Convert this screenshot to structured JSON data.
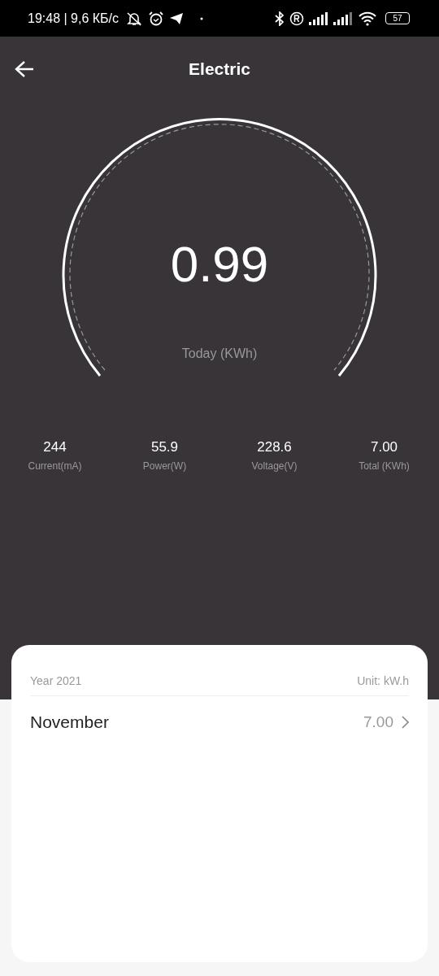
{
  "status_bar": {
    "time": "19:48 | 9,6 КБ/с",
    "battery": "57"
  },
  "header": {
    "title": "Electric"
  },
  "gauge": {
    "value": "0.99",
    "label": "Today (KWh)"
  },
  "stats": [
    {
      "value": "244",
      "label": "Current(mA)"
    },
    {
      "value": "55.9",
      "label": "Power(W)"
    },
    {
      "value": "228.6",
      "label": "Voltage(V)"
    },
    {
      "value": "7.00",
      "label": "Total (KWh)"
    }
  ],
  "history": {
    "year": "Year 2021",
    "unit": "Unit: kW.h",
    "rows": [
      {
        "month": "November",
        "value": "7.00"
      }
    ]
  }
}
